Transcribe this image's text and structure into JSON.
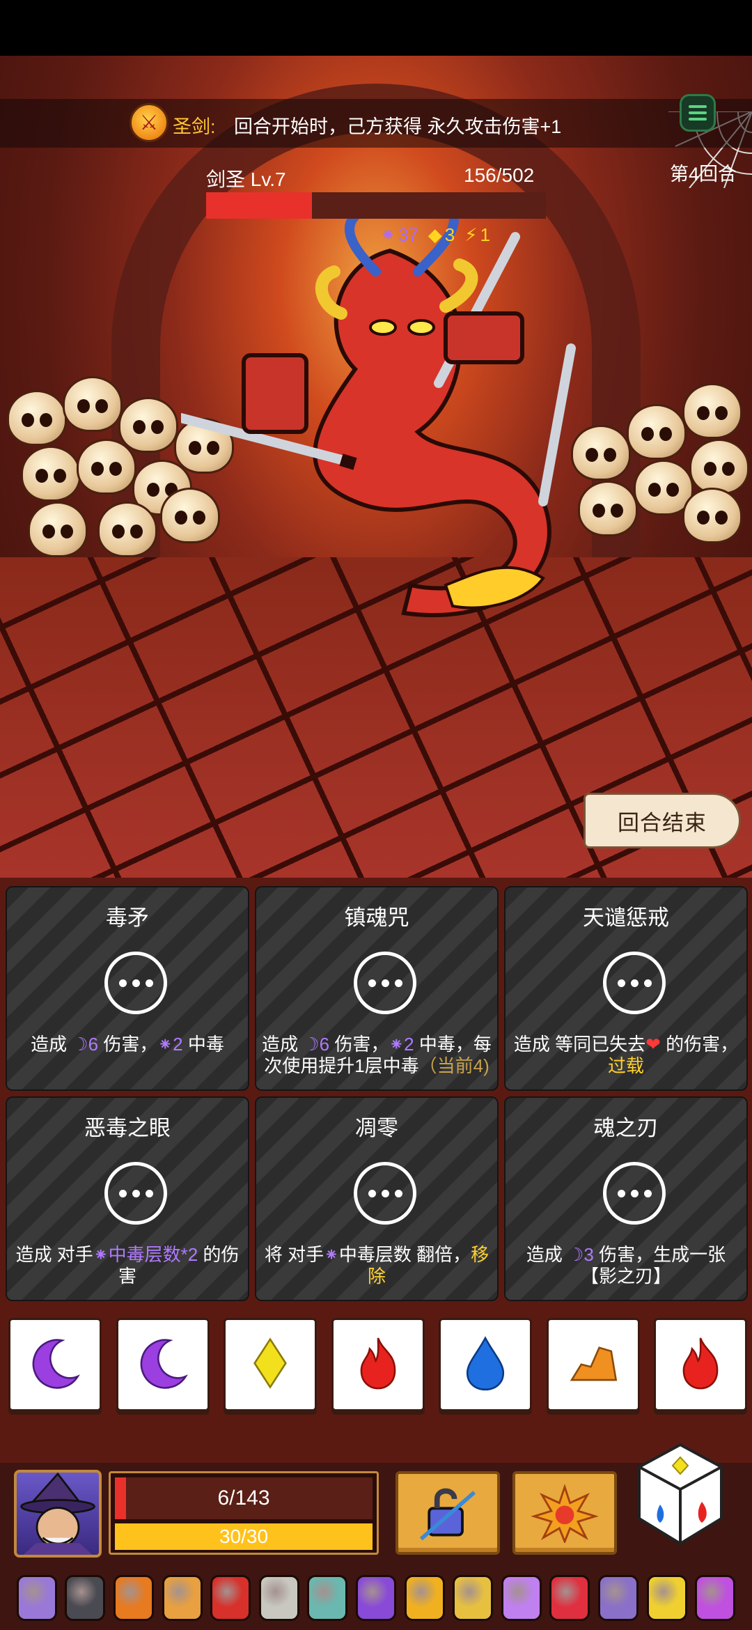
{
  "buff": {
    "name": "圣剑:",
    "description": "回合开始时，己方获得 永久攻击伤害+1",
    "icon": "flaming-sword-icon"
  },
  "enemy": {
    "name": "剑圣 Lv.7",
    "hp_text": "156/502",
    "hp_current": 156,
    "hp_max": 502,
    "statuses": [
      {
        "icon": "poison-icon",
        "value": "37",
        "color": "#a96bff"
      },
      {
        "icon": "armor-icon",
        "value": "3",
        "color": "#ffd520"
      },
      {
        "icon": "lightning-icon",
        "value": "1",
        "color": "#ffd520"
      }
    ]
  },
  "round": "第4回合",
  "end_turn_label": "回合结束",
  "cards": [
    {
      "title": "毒矛",
      "desc": [
        {
          "t": "造成 "
        },
        {
          "t": "☽6",
          "c": "purple"
        },
        {
          "t": " 伤害，"
        },
        {
          "t": "⁕2",
          "c": "purple"
        },
        {
          "t": " 中毒"
        }
      ]
    },
    {
      "title": "镇魂咒",
      "desc": [
        {
          "t": "造成 "
        },
        {
          "t": "☽6",
          "c": "purple"
        },
        {
          "t": " 伤害，"
        },
        {
          "t": "⁕2",
          "c": "purple"
        },
        {
          "t": " 中毒，每次使用提升1层中毒"
        },
        {
          "t": "（当前4)",
          "c": "gold"
        }
      ]
    },
    {
      "title": "天谴惩戒",
      "desc": [
        {
          "t": "造成 等同已失去"
        },
        {
          "t": "❤",
          "c": "red"
        },
        {
          "t": " 的伤害，"
        },
        {
          "t": "过载",
          "c": "yellow"
        }
      ]
    },
    {
      "title": "恶毒之眼",
      "desc": [
        {
          "t": "造成 对手"
        },
        {
          "t": "⁕中毒层数*2",
          "c": "purple"
        },
        {
          "t": " 的伤害"
        }
      ]
    },
    {
      "title": "凋零",
      "desc": [
        {
          "t": "将 对手"
        },
        {
          "t": "⁕",
          "c": "purple"
        },
        {
          "t": "中毒层数 翻倍，"
        },
        {
          "t": "移除",
          "c": "yellow"
        }
      ]
    },
    {
      "title": "魂之刃",
      "desc": [
        {
          "t": "造成 "
        },
        {
          "t": "☽3",
          "c": "purple"
        },
        {
          "t": " 伤害，生成一张【影之刃】"
        }
      ]
    }
  ],
  "dice": [
    {
      "icon": "moon-icon",
      "color": "#9b3fe0"
    },
    {
      "icon": "moon-icon",
      "color": "#9b3fe0"
    },
    {
      "icon": "diamond-icon",
      "color": "#f2e01c"
    },
    {
      "icon": "fire-icon",
      "color": "#e8231f"
    },
    {
      "icon": "water-drop-icon",
      "color": "#1f6fe0"
    },
    {
      "icon": "earth-rock-icon",
      "color": "#f09020"
    },
    {
      "icon": "fire-icon",
      "color": "#e8231f"
    }
  ],
  "player": {
    "hp_text": "6/143",
    "hp_current": 6,
    "hp_max": 143,
    "energy_text": "30/30",
    "energy_current": 30,
    "energy_max": 30
  },
  "skills": [
    {
      "icon": "unlock-icon"
    },
    {
      "icon": "explosion-icon"
    }
  ],
  "relics": [
    {
      "icon": "boot-icon",
      "color": "#9a78d8"
    },
    {
      "icon": "shield-icon",
      "color": "#4a4a52"
    },
    {
      "icon": "torch-icon",
      "color": "#e87a20"
    },
    {
      "icon": "glove-icon",
      "color": "#e8a040"
    },
    {
      "icon": "serpent-icon",
      "color": "#d8302a"
    },
    {
      "icon": "scroll-icon",
      "color": "#c8c8c0"
    },
    {
      "icon": "feather-icon",
      "color": "#6ab8b0"
    },
    {
      "icon": "potion-icon",
      "color": "#8a4ad8"
    },
    {
      "icon": "flame-crown-icon",
      "color": "#f0b020"
    },
    {
      "icon": "ring-icon",
      "color": "#e8c040"
    },
    {
      "icon": "moon-relic-icon",
      "color": "#c080f0"
    },
    {
      "icon": "gem-icon",
      "color": "#e03040"
    },
    {
      "icon": "crescent-icon",
      "color": "#8a70c8"
    },
    {
      "icon": "chain-icon",
      "color": "#f0d030"
    },
    {
      "icon": "slime-icon",
      "color": "#c050e0"
    }
  ]
}
